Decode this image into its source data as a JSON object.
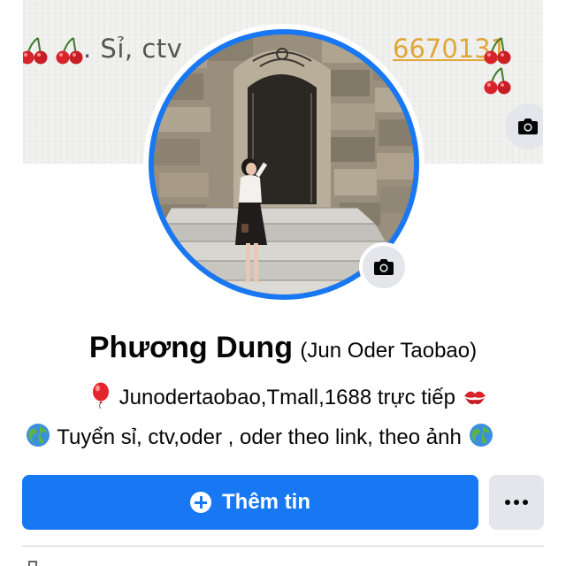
{
  "cover": {
    "text_left": ". Sỉ, ctv",
    "text_phone": "6670131",
    "camera_icon": "camera-icon"
  },
  "profile": {
    "name": "Phương Dung",
    "alt_name": "(Jun Oder Taobao)",
    "bio_line1": "Junodertaobao,Tmall,1688 trực tiếp",
    "bio_line2": "Tuyển sỉ, ctv,oder , oder theo link, theo ảnh",
    "avatar_camera_icon": "camera-icon"
  },
  "actions": {
    "primary_label": "Thêm tin",
    "primary_icon": "plus-circle-icon",
    "more_icon": "more-horizontal-icon"
  },
  "colors": {
    "accent": "#1877f2",
    "secondary_button": "#e4e6eb",
    "text": "#050505"
  }
}
